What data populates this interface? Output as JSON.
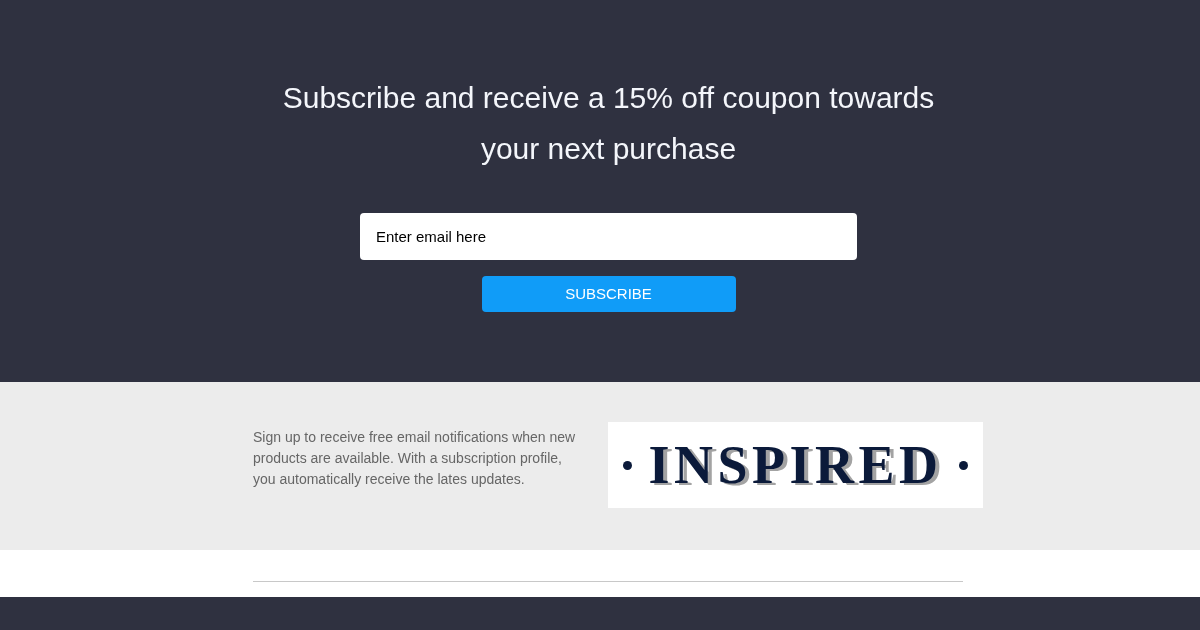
{
  "hero": {
    "heading": "Subscribe and receive a 15% off coupon towards your next purchase",
    "email_field": {
      "placeholder": "Enter email here"
    },
    "subscribe_button": "SUBSCRIBE"
  },
  "info": {
    "text": "Sign up to receive free email notifications when new products are available. With a subscription profile, you automatically receive the lates updates.",
    "logo": {
      "text": "INSPIRED"
    }
  }
}
